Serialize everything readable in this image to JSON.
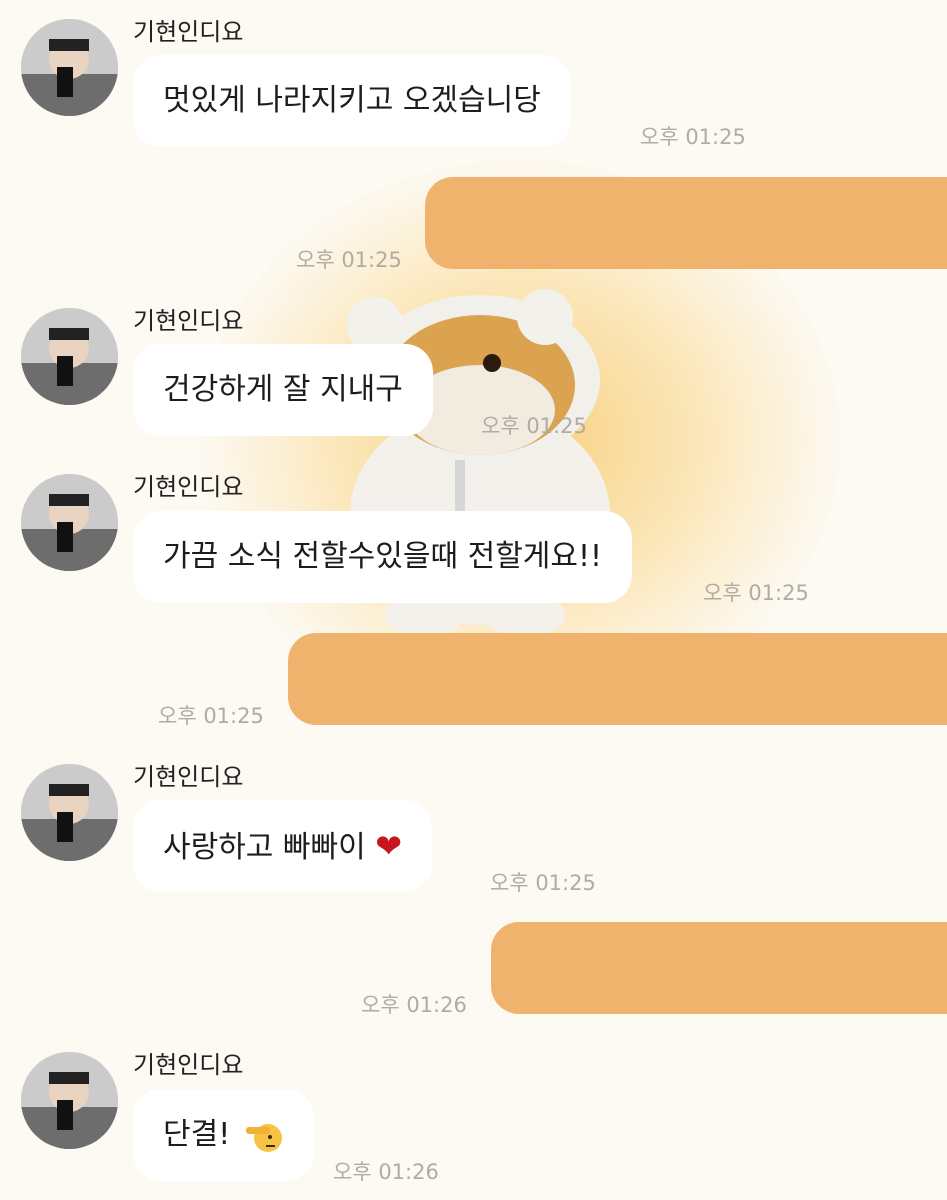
{
  "colors": {
    "background": "#fdfaf3",
    "incoming_bubble": "#ffffff",
    "outgoing_bubble": "#f0b36e",
    "time_text": "#b0aca4"
  },
  "messages": [
    {
      "direction": "incoming",
      "sender": "기현인디요",
      "text": "멋있게 나라지키고 오겠습니당",
      "time": "오후 01:25"
    },
    {
      "direction": "outgoing",
      "text": "",
      "time": "오후 01:25"
    },
    {
      "direction": "incoming",
      "sender": "기현인디요",
      "text": "건강하게 잘 지내구",
      "time": "오후 01:25"
    },
    {
      "direction": "incoming",
      "sender": "기현인디요",
      "text": "가끔 소식 전할수있을때 전할게요!!",
      "time": "오후 01:25"
    },
    {
      "direction": "outgoing",
      "text": "",
      "time": "오후 01:25"
    },
    {
      "direction": "incoming",
      "sender": "기현인디요",
      "text": "사랑하고 빠빠이",
      "emoji": "heart-emoji",
      "time": "오후 01:25"
    },
    {
      "direction": "outgoing",
      "text": "",
      "time": "오후 01:26"
    },
    {
      "direction": "incoming",
      "sender": "기현인디요",
      "text": "단결!",
      "emoji": "saluting-face-emoji",
      "time": "오후 01:26"
    }
  ]
}
